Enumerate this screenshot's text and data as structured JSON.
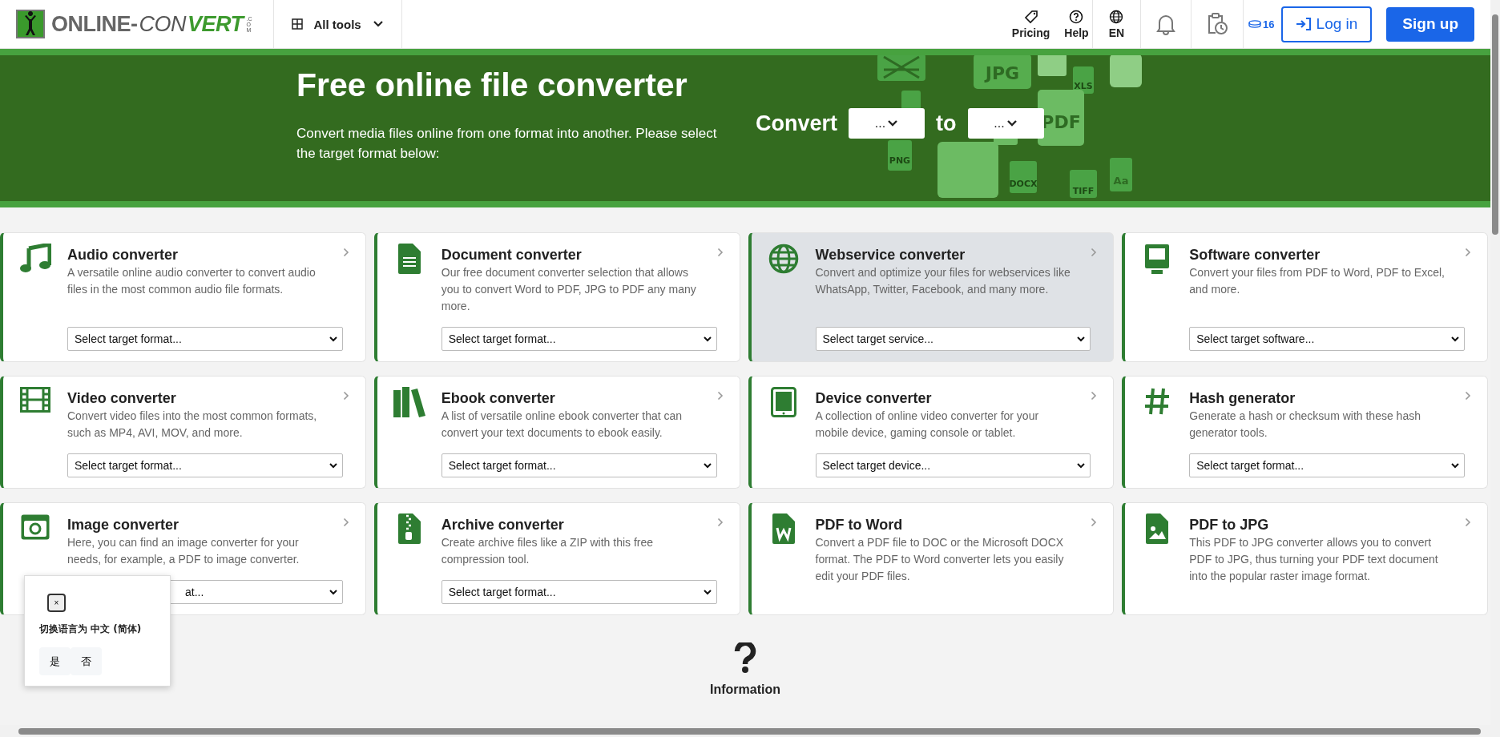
{
  "header": {
    "logo": {
      "parts": [
        {
          "text": "ONLINE-",
          "kind": "plain"
        },
        {
          "text": "CON",
          "kind": "italic"
        },
        {
          "text": "VERT",
          "kind": "accent"
        }
      ],
      "suffix": ".COM"
    },
    "all_tools": "All tools",
    "pricing": "Pricing",
    "help": "Help",
    "language": "EN",
    "credits": "16",
    "login": "Log in",
    "signup": "Sign up"
  },
  "banner": {
    "title": "Free online file converter",
    "subtitle": "Convert media files online from one format into another. Please select the target format below:",
    "convert_label": "Convert",
    "from_value": "...",
    "to_label": "to",
    "to_value": "...",
    "art_labels": [
      "JPG",
      "XLS",
      "PDF",
      "PNG",
      "DOCX",
      "TIFF",
      "Aa"
    ]
  },
  "cards": [
    {
      "title": "Audio converter",
      "description": "A versatile online audio converter to convert audio files in the most common audio file formats.",
      "select": "Select target format...",
      "highlighted": false
    },
    {
      "title": "Document converter",
      "description": "Our free document converter selection that allows you to convert Word to PDF, JPG to PDF any many more.",
      "select": "Select target format...",
      "highlighted": false
    },
    {
      "title": "Webservice converter",
      "description": "Convert and optimize your files for webservices like WhatsApp, Twitter, Facebook, and many more.",
      "select": "Select target service...",
      "highlighted": true
    },
    {
      "title": "Software converter",
      "description": "Convert your files from PDF to Word, PDF to Excel, and more.",
      "select": "Select target software...",
      "highlighted": false
    },
    {
      "title": "Video converter",
      "description": "Convert video files into the most common formats, such as MP4, AVI, MOV, and more.",
      "select": "Select target format...",
      "highlighted": false
    },
    {
      "title": "Ebook converter",
      "description": "A list of versatile online ebook converter that can convert your text documents to ebook easily.",
      "select": "Select target format...",
      "highlighted": false
    },
    {
      "title": "Device converter",
      "description": "A collection of online video converter for your mobile device, gaming console or tablet.",
      "select": "Select target device...",
      "highlighted": false
    },
    {
      "title": "Hash generator",
      "description": "Generate a hash or checksum with these hash generator tools.",
      "select": "Select target format...",
      "highlighted": false
    },
    {
      "title": "Image converter",
      "description": "Here, you can find an image converter for your needs, for example, a PDF to image converter.",
      "select": "at...",
      "select_covered": true,
      "highlighted": false
    },
    {
      "title": "Archive converter",
      "description": "Create archive files like a ZIP with this free compression tool.",
      "select": "Select target format...",
      "highlighted": false
    },
    {
      "title": "PDF to Word",
      "description": "Convert a PDF file to DOC or the Microsoft DOCX format. The PDF to Word converter lets you easily edit your PDF files.",
      "highlighted": false
    },
    {
      "title": "PDF to JPG",
      "description": "This PDF to JPG converter allows you to convert PDF to JPG, thus turning your PDF text document into the popular raster image format.",
      "highlighted": false
    }
  ],
  "information": {
    "title": "Information"
  },
  "language_popup": {
    "close": "×",
    "message": "切换语言为 中文 (简体)",
    "buttons": [
      "是",
      "否"
    ]
  }
}
